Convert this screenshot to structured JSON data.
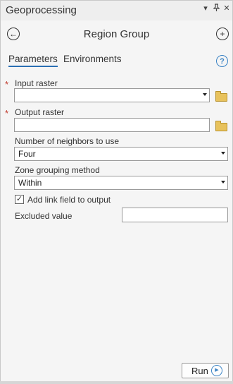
{
  "window": {
    "title": "Geoprocessing",
    "pin_glyph": "▾",
    "pin_icon": "pin-icon",
    "close_glyph": "✕"
  },
  "header": {
    "back_glyph": "←",
    "tool_title": "Region Group",
    "add_glyph": "+"
  },
  "tabs": [
    {
      "label": "Parameters",
      "active": true
    },
    {
      "label": "Environments",
      "active": false
    }
  ],
  "help_glyph": "?",
  "params": {
    "input_raster": {
      "label": "Input raster",
      "value": "",
      "required": true
    },
    "output_raster": {
      "label": "Output raster",
      "value": "",
      "required": true
    },
    "neighbors": {
      "label": "Number of neighbors to use",
      "value": "Four"
    },
    "zone_method": {
      "label": "Zone grouping method",
      "value": "Within"
    },
    "add_link": {
      "label": "Add link field to output",
      "checked": true,
      "check_glyph": "✓"
    },
    "excluded": {
      "label": "Excluded value",
      "value": ""
    }
  },
  "required_glyph": "*",
  "run": {
    "label": "Run",
    "icon_glyph": "▶"
  }
}
